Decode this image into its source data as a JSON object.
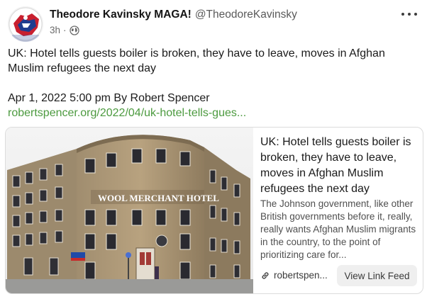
{
  "post": {
    "author_name": "Theodore Kavinsky MAGA!",
    "author_handle": "@TheodoreKavinsky",
    "timestamp": "3h",
    "visibility_icon": "globe-icon",
    "more_icon": "more-horizontal-icon",
    "text_line_1": "UK: Hotel tells guests boiler is broken, they have to leave, moves in Afghan Muslim refugees the next day",
    "text_line_2": "Apr 1, 2022 5:00 pm By Robert Spencer",
    "link_text": "robertspencer.org/2022/04/uk-hotel-tells-gues..."
  },
  "link_card": {
    "title": "UK: Hotel tells guests boiler is broken, they have to leave, moves in Afghan Muslim refugees the next day",
    "description": "The Johnson government, like other British governments before it, really, really wants Afghan Muslim migrants in the country, to the point of prioritizing care for...",
    "domain": "robertspen...",
    "view_button_label": "View Link Feed",
    "image_sign_text": "WOOL MERCHANT HOTEL",
    "image_alt": "Wool Merchant Hotel building"
  },
  "colors": {
    "link_green": "#4c9a3f",
    "button_bg": "#efefef",
    "card_border": "#dcdcdc"
  }
}
